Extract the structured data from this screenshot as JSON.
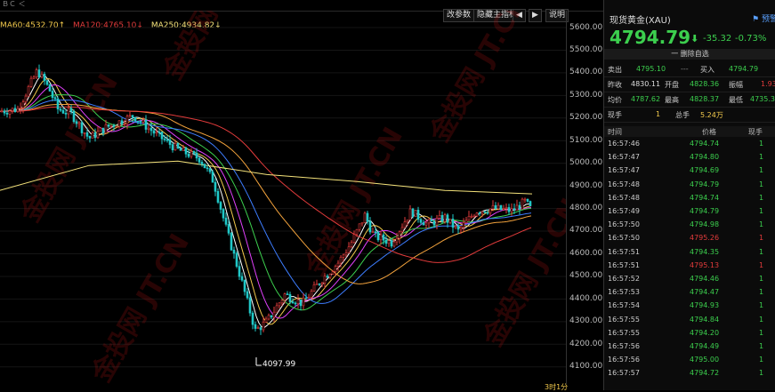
{
  "toolbar": {
    "partial_left": "ＢＣ ＜",
    "params_label": "改参数",
    "hide_indicator_label": "隐藏主指标",
    "explain_label": "说明"
  },
  "ma_legend": {
    "items": [
      {
        "text": "MA60:4532.70↑",
        "color": "#f2c94c"
      },
      {
        "text": "MA120:4765.10↓",
        "color": "#e23b3b"
      },
      {
        "text": "MA250:4934.82↓",
        "color": "#f4e27a"
      }
    ]
  },
  "price_axis": [
    "5600.00",
    "5500.00",
    "5400.00",
    "5300.00",
    "5200.00",
    "5100.00",
    "5000.00",
    "4900.00",
    "4800.00",
    "4700.00",
    "4600.00",
    "4500.00",
    "4400.00",
    "4300.00",
    "4200.00",
    "4100.00"
  ],
  "low_marker": "4097.99",
  "period": "3时1分",
  "watermark": "金投网 JT.CN",
  "colors": {
    "up": "#e23b3b",
    "down": "#3ccf4e",
    "accent": "#5aa0ff"
  },
  "quote": {
    "title": "现货黄金(XAU)",
    "add_label": "预警",
    "price": "4794.79",
    "arrow": "⬇",
    "change": "-35.32",
    "change_pct": "-0.73%",
    "remove_label": "一 删除自选",
    "sell_label": "卖出",
    "sell": "4795.10",
    "sell_dash": "---",
    "buy_label": "买入",
    "buy": "4794.79",
    "prev_close_label": "昨收",
    "prev_close": "4830.11",
    "open_label": "开盘",
    "open": "4828.36",
    "amp_label": "振幅",
    "amp": "1.93",
    "avg_label": "均价",
    "avg": "4787.62",
    "high_label": "最高",
    "high": "4828.37",
    "low_label": "最低",
    "low": "4735.3",
    "now_hand_label": "现手",
    "now_hand": "1",
    "total_hand_label": "总手",
    "total_hand": "5.24万"
  },
  "ticks_header": {
    "time": "时间",
    "price": "价格",
    "vol": "现手"
  },
  "ticks": [
    {
      "time": "16:57:46",
      "price": "4794.74",
      "vol": "1",
      "dir": "down"
    },
    {
      "time": "16:57:47",
      "price": "4794.80",
      "vol": "1",
      "dir": "down"
    },
    {
      "time": "16:57:47",
      "price": "4794.69",
      "vol": "1",
      "dir": "down"
    },
    {
      "time": "16:57:48",
      "price": "4794.79",
      "vol": "1",
      "dir": "down"
    },
    {
      "time": "16:57:48",
      "price": "4794.74",
      "vol": "1",
      "dir": "down"
    },
    {
      "time": "16:57:49",
      "price": "4794.79",
      "vol": "1",
      "dir": "down"
    },
    {
      "time": "16:57:50",
      "price": "4794.98",
      "vol": "1",
      "dir": "down"
    },
    {
      "time": "16:57:50",
      "price": "4795.26",
      "vol": "1",
      "dir": "up"
    },
    {
      "time": "16:57:51",
      "price": "4794.35",
      "vol": "1",
      "dir": "down"
    },
    {
      "time": "16:57:51",
      "price": "4795.13",
      "vol": "1",
      "dir": "up"
    },
    {
      "time": "16:57:52",
      "price": "4794.46",
      "vol": "1",
      "dir": "down"
    },
    {
      "time": "16:57:53",
      "price": "4794.47",
      "vol": "1",
      "dir": "down"
    },
    {
      "time": "16:57:54",
      "price": "4794.93",
      "vol": "1",
      "dir": "down"
    },
    {
      "time": "16:57:55",
      "price": "4794.84",
      "vol": "1",
      "dir": "down"
    },
    {
      "time": "16:57:55",
      "price": "4794.20",
      "vol": "1",
      "dir": "down"
    },
    {
      "time": "16:57:56",
      "price": "4794.49",
      "vol": "1",
      "dir": "down"
    },
    {
      "time": "16:57:56",
      "price": "4795.00",
      "vol": "1",
      "dir": "down"
    },
    {
      "time": "16:57:57",
      "price": "4794.72",
      "vol": "1",
      "dir": "down"
    }
  ]
}
